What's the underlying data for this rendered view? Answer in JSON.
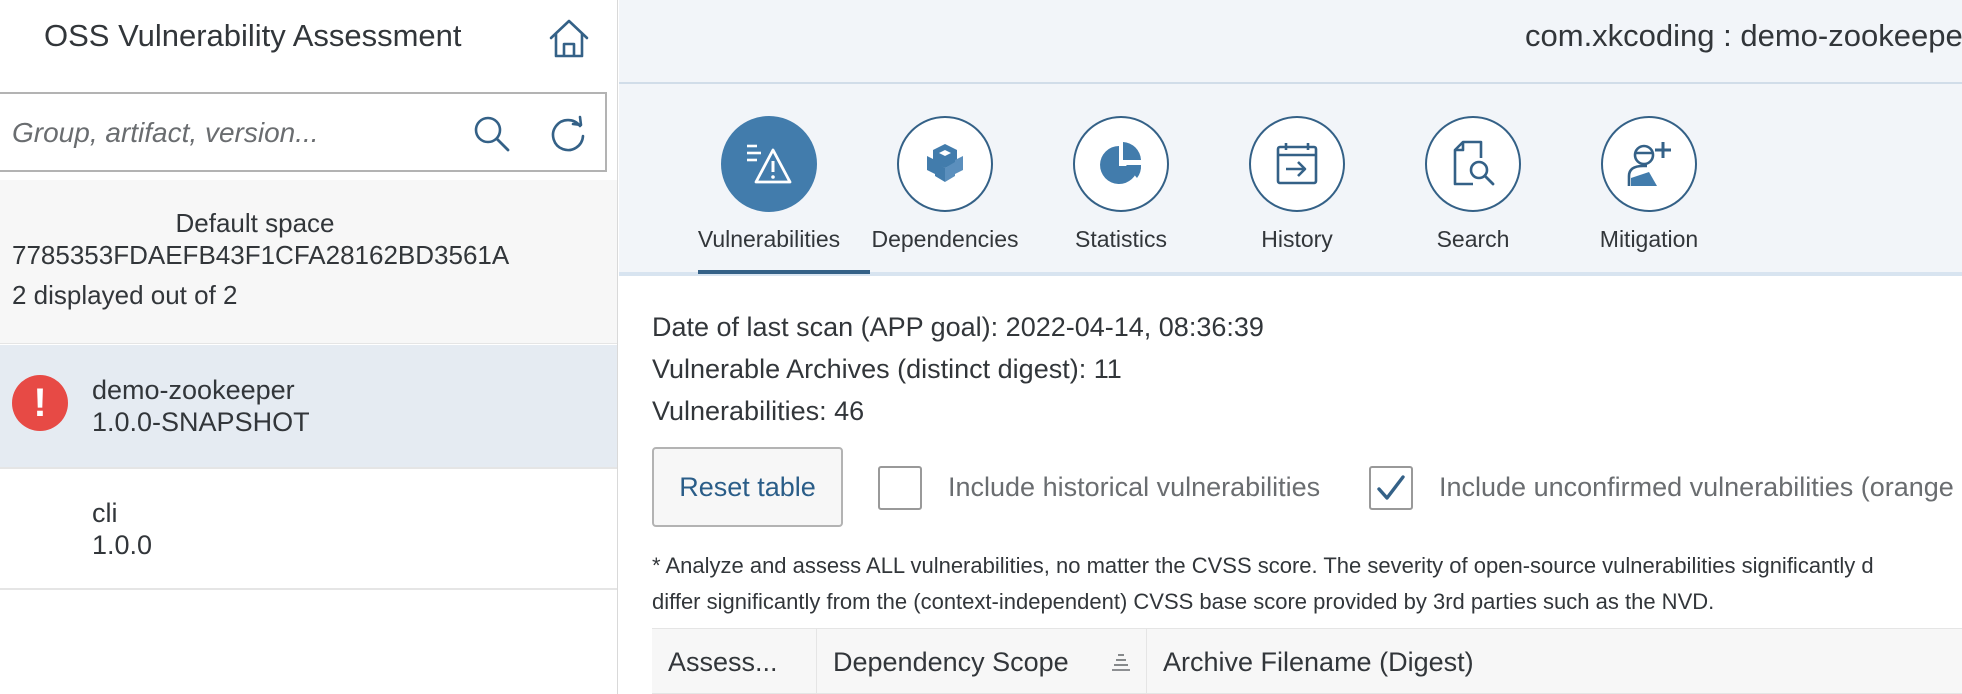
{
  "master": {
    "title": "OSS Vulnerability Assessment",
    "search_placeholder": "Group, artifact, version...",
    "space": {
      "name": "Default space",
      "id": "7785353FDAEFB43F1CFA28162BD3561A",
      "count_text": "2 displayed out of 2"
    },
    "items": [
      {
        "name": "demo-zookeeper",
        "version": "1.0.0-SNAPSHOT",
        "status": "error",
        "status_glyph": "!"
      },
      {
        "name": "cli",
        "version": "1.0.0"
      }
    ]
  },
  "detail": {
    "title": "com.xkcoding : demo-zookeeper",
    "tabs": [
      {
        "label": "Vulnerabilities",
        "icon": "vulnerabilities-icon",
        "active": true
      },
      {
        "label": "Dependencies",
        "icon": "dependencies-icon"
      },
      {
        "label": "Statistics",
        "icon": "statistics-icon"
      },
      {
        "label": "History",
        "icon": "history-icon"
      },
      {
        "label": "Search",
        "icon": "search-document-icon"
      },
      {
        "label": "Mitigation",
        "icon": "mitigation-icon"
      }
    ],
    "info": {
      "last_scan": "Date of last scan (APP goal): 2022-04-14, 08:36:39",
      "vulnerable_archives": "Vulnerable Archives (distinct digest): 11",
      "vulnerabilities": "Vulnerabilities: 46"
    },
    "reset_label": "Reset table",
    "checkboxes": [
      {
        "label": "Include historical vulnerabilities",
        "checked": false
      },
      {
        "label": "Include unconfirmed vulnerabilities (orange",
        "checked": true
      }
    ],
    "note_line1": "* Analyze and assess ALL vulnerabilities, no matter the CVSS score. The severity of open-source vulnerabilities significantly d",
    "note_line2": "differ significantly from the (context-independent) CVSS base score provided by 3rd parties such as the NVD.",
    "columns": [
      "Assess...",
      "Dependency Scope",
      "Archive Filename (Digest)"
    ]
  },
  "colors": {
    "accent": "#427cac",
    "accent_dark": "#346187",
    "error": "#e74a45",
    "selected_bg": "#e5ebf2",
    "header_bg": "#f2f5f9"
  }
}
